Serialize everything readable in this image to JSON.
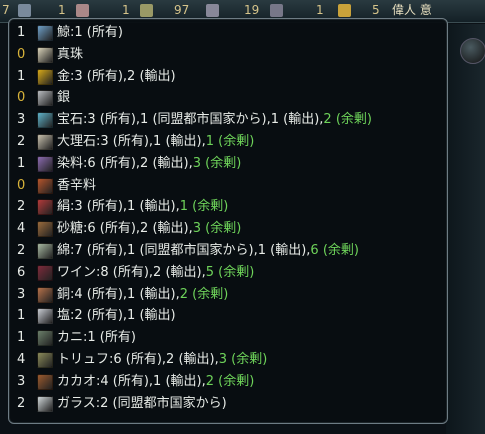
{
  "topbar": {
    "items": [
      "7",
      "1",
      "1",
      "97",
      "19",
      "1",
      "5",
      "偉人 意"
    ]
  },
  "resources": [
    {
      "count": "1",
      "icon": "whale-icon",
      "color": "#6fa0c8",
      "text": "鯨:1 (所有)",
      "surplus": ""
    },
    {
      "count": "0",
      "icon": "pearl-icon",
      "color": "#d8d2b8",
      "text": "真珠",
      "surplus": ""
    },
    {
      "count": "1",
      "icon": "gold-icon",
      "color": "#d7a919",
      "text": "金:3 (所有),2 (輸出)",
      "surplus": ""
    },
    {
      "count": "0",
      "icon": "silver-icon",
      "color": "#b9bcc0",
      "text": "銀",
      "surplus": ""
    },
    {
      "count": "3",
      "icon": "gems-icon",
      "color": "#5fb2c9",
      "text": "宝石:3 (所有),1 (同盟都市国家から),1 (輸出),",
      "surplus": "2 (余剰)"
    },
    {
      "count": "2",
      "icon": "marble-icon",
      "color": "#c7c0ad",
      "text": "大理石:3 (所有),1 (輸出),",
      "surplus": "1 (余剰)"
    },
    {
      "count": "1",
      "icon": "dyes-icon",
      "color": "#8b6bb0",
      "text": "染料:6 (所有),2 (輸出),",
      "surplus": "3 (余剰)"
    },
    {
      "count": "0",
      "icon": "spices-icon",
      "color": "#b5552c",
      "text": "香辛料",
      "surplus": ""
    },
    {
      "count": "2",
      "icon": "silk-icon",
      "color": "#b23a3a",
      "text": "絹:3 (所有),1 (輸出),",
      "surplus": "1 (余剰)"
    },
    {
      "count": "4",
      "icon": "sugar-icon",
      "color": "#9a6b3c",
      "text": "砂糖:6 (所有),2 (輸出),",
      "surplus": "3 (余剰)"
    },
    {
      "count": "2",
      "icon": "cotton-icon",
      "color": "#a7b9a2",
      "text": "綿:7 (所有),1 (同盟都市国家から),1 (輸出),",
      "surplus": "6 (余剰)"
    },
    {
      "count": "6",
      "icon": "wine-icon",
      "color": "#7d2b3b",
      "text": "ワイン:8 (所有),2 (輸出),",
      "surplus": "5 (余剰)"
    },
    {
      "count": "3",
      "icon": "copper-icon",
      "color": "#b5714a",
      "text": "銅:4 (所有),1 (輸出),",
      "surplus": "2 (余剰)"
    },
    {
      "count": "1",
      "icon": "salt-icon",
      "color": "#c7cbd2",
      "text": "塩:2 (所有),1 (輸出)",
      "surplus": ""
    },
    {
      "count": "1",
      "icon": "crab-icon",
      "color": "#6b7f6a",
      "text": "カニ:1 (所有)",
      "surplus": ""
    },
    {
      "count": "4",
      "icon": "truffles-icon",
      "color": "#8a8a5a",
      "text": "トリュフ:6 (所有),2 (輸出),",
      "surplus": "3 (余剰)"
    },
    {
      "count": "3",
      "icon": "cocoa-icon",
      "color": "#9b5a2e",
      "text": "カカオ:4 (所有),1 (輸出),",
      "surplus": "2 (余剰)"
    },
    {
      "count": "2",
      "icon": "glass-icon",
      "color": "#cfd6d8",
      "text": "ガラス:2 (同盟都市国家から)",
      "surplus": ""
    }
  ]
}
